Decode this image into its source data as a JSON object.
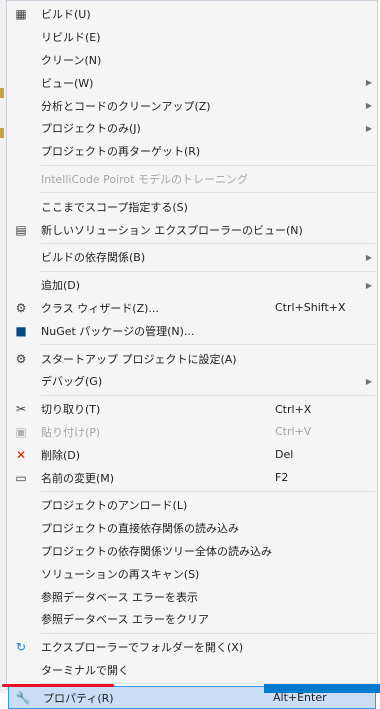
{
  "menu": {
    "items": [
      {
        "type": "item",
        "icon": "build-icon",
        "glyph": "▦",
        "icolor": "#3c3c3c",
        "label": "ビルド(U)",
        "shortcut": "",
        "submenu": false,
        "disabled": false
      },
      {
        "type": "item",
        "icon": "",
        "glyph": "",
        "label": "リビルド(E)",
        "shortcut": "",
        "submenu": false,
        "disabled": false
      },
      {
        "type": "item",
        "icon": "",
        "glyph": "",
        "label": "クリーン(N)",
        "shortcut": "",
        "submenu": false,
        "disabled": false
      },
      {
        "type": "item",
        "icon": "",
        "glyph": "",
        "label": "ビュー(W)",
        "shortcut": "",
        "submenu": true,
        "disabled": false
      },
      {
        "type": "item",
        "icon": "",
        "glyph": "",
        "label": "分析とコードのクリーンアップ(Z)",
        "shortcut": "",
        "submenu": true,
        "disabled": false
      },
      {
        "type": "item",
        "icon": "",
        "glyph": "",
        "label": "プロジェクトのみ(J)",
        "shortcut": "",
        "submenu": true,
        "disabled": false
      },
      {
        "type": "item",
        "icon": "",
        "glyph": "",
        "label": "プロジェクトの再ターゲット(R)",
        "shortcut": "",
        "submenu": false,
        "disabled": false
      },
      {
        "type": "sep"
      },
      {
        "type": "item",
        "icon": "",
        "glyph": "",
        "label": "IntelliCode Poirot モデルのトレーニング",
        "shortcut": "",
        "submenu": false,
        "disabled": true
      },
      {
        "type": "sep"
      },
      {
        "type": "item",
        "icon": "",
        "glyph": "",
        "label": "ここまでスコープ指定する(S)",
        "shortcut": "",
        "submenu": false,
        "disabled": false
      },
      {
        "type": "item",
        "icon": "new-solution-explorer-view-icon",
        "glyph": "▤",
        "icolor": "#3c3c3c",
        "label": "新しいソリューション エクスプローラーのビュー(N)",
        "shortcut": "",
        "submenu": false,
        "disabled": false
      },
      {
        "type": "sep"
      },
      {
        "type": "item",
        "icon": "",
        "glyph": "",
        "label": "ビルドの依存関係(B)",
        "shortcut": "",
        "submenu": true,
        "disabled": false
      },
      {
        "type": "sep"
      },
      {
        "type": "item",
        "icon": "",
        "glyph": "",
        "label": "追加(D)",
        "shortcut": "",
        "submenu": true,
        "disabled": false
      },
      {
        "type": "item",
        "icon": "class-wizard-icon",
        "glyph": "⚙",
        "icolor": "#3c3c3c",
        "label": "クラス ウィザード(Z)...",
        "shortcut": "Ctrl+Shift+X",
        "submenu": false,
        "disabled": false
      },
      {
        "type": "item",
        "icon": "nuget-icon",
        "glyph": "■",
        "icolor": "#004880",
        "label": "NuGet パッケージの管理(N)...",
        "shortcut": "",
        "submenu": false,
        "disabled": false
      },
      {
        "type": "sep"
      },
      {
        "type": "item",
        "icon": "gear-icon",
        "glyph": "⚙",
        "icolor": "#3c3c3c",
        "label": "スタートアップ プロジェクトに設定(A)",
        "shortcut": "",
        "submenu": false,
        "disabled": false
      },
      {
        "type": "item",
        "icon": "",
        "glyph": "",
        "label": "デバッグ(G)",
        "shortcut": "",
        "submenu": true,
        "disabled": false
      },
      {
        "type": "sep"
      },
      {
        "type": "item",
        "icon": "scissors-icon",
        "glyph": "✂",
        "icolor": "#3c3c3c",
        "label": "切り取り(T)",
        "shortcut": "Ctrl+X",
        "submenu": false,
        "disabled": false
      },
      {
        "type": "item",
        "icon": "paste-icon",
        "glyph": "▣",
        "icolor": "#b0b0b0",
        "label": "貼り付け(P)",
        "shortcut": "Ctrl+V",
        "submenu": false,
        "disabled": true
      },
      {
        "type": "item",
        "icon": "delete-icon",
        "glyph": "✕",
        "icolor": "#e51400",
        "label": "削除(D)",
        "shortcut": "Del",
        "submenu": false,
        "disabled": false
      },
      {
        "type": "item",
        "icon": "rename-icon",
        "glyph": "▭",
        "icolor": "#3c3c3c",
        "label": "名前の変更(M)",
        "shortcut": "F2",
        "submenu": false,
        "disabled": false
      },
      {
        "type": "sep"
      },
      {
        "type": "item",
        "icon": "",
        "glyph": "",
        "label": "プロジェクトのアンロード(L)",
        "shortcut": "",
        "submenu": false,
        "disabled": false
      },
      {
        "type": "item",
        "icon": "",
        "glyph": "",
        "label": "プロジェクトの直接依存関係の読み込み",
        "shortcut": "",
        "submenu": false,
        "disabled": false
      },
      {
        "type": "item",
        "icon": "",
        "glyph": "",
        "label": "プロジェクトの依存関係ツリー全体の読み込み",
        "shortcut": "",
        "submenu": false,
        "disabled": false
      },
      {
        "type": "item",
        "icon": "",
        "glyph": "",
        "label": "ソリューションの再スキャン(S)",
        "shortcut": "",
        "submenu": false,
        "disabled": false
      },
      {
        "type": "item",
        "icon": "",
        "glyph": "",
        "label": "参照データベース エラーを表示",
        "shortcut": "",
        "submenu": false,
        "disabled": false
      },
      {
        "type": "item",
        "icon": "",
        "glyph": "",
        "label": "参照データベース エラーをクリア",
        "shortcut": "",
        "submenu": false,
        "disabled": false
      },
      {
        "type": "sep"
      },
      {
        "type": "item",
        "icon": "open-folder-explorer-icon",
        "glyph": "↻",
        "icolor": "#1e7ad1",
        "label": "エクスプローラーでフォルダーを開く(X)",
        "shortcut": "",
        "submenu": false,
        "disabled": false
      },
      {
        "type": "item",
        "icon": "",
        "glyph": "",
        "label": "ターミナルで開く",
        "shortcut": "",
        "submenu": false,
        "disabled": false
      },
      {
        "type": "sep"
      },
      {
        "type": "item",
        "icon": "wrench-icon",
        "glyph": "🔧",
        "icolor": "#3c3c3c",
        "label": "プロパティ(R)",
        "shortcut": "Alt+Enter",
        "submenu": false,
        "disabled": false,
        "highlight": true
      }
    ]
  },
  "colors": {
    "highlight_bg": "#c9def5",
    "highlight_border": "#3399ff",
    "annotation_red": "#e81123"
  }
}
